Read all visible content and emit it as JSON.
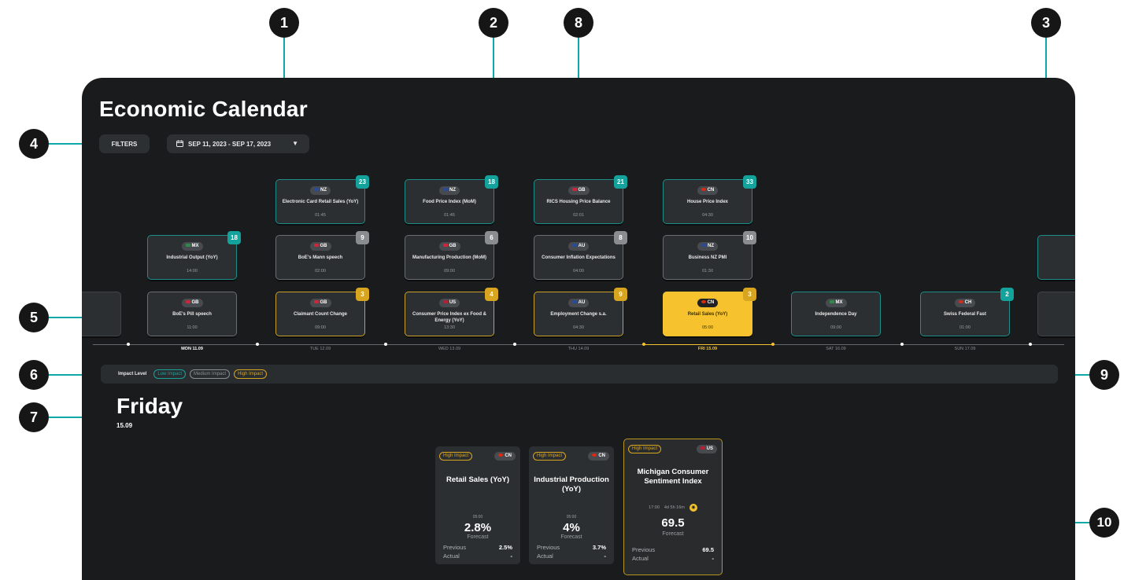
{
  "app": {
    "title": "Economic Calendar",
    "filters_label": "FILTERS",
    "date_range": "SEP 11, 2023 - SEP 17, 2023",
    "dropdown_arrow": "▼",
    "calendar_icon": "calendar-icon"
  },
  "colors": {
    "panel": "#191b1d",
    "low_impact": "#14a39c",
    "medium_impact": "#8a8d90",
    "high_impact": "#d8a520",
    "selected": "#f6c32e",
    "annotation_line": "#0fa7a7"
  },
  "cards": {
    "c1": {
      "flag": "NZ",
      "event": "Electronic Card Retail Sales (YoY)",
      "time": "01:45",
      "count": "23"
    },
    "c2": {
      "flag": "NZ",
      "event": "Food Price Index (MoM)",
      "time": "01:45",
      "count": "18"
    },
    "c3": {
      "flag": "GB",
      "event": "RICS Housing Price Balance",
      "time": "02:01",
      "count": "21"
    },
    "c4": {
      "flag": "CN",
      "event": "House Price Index",
      "time": "04:30",
      "count": "33"
    },
    "c5": {
      "flag": "MX",
      "event": "Industrial Output (YoY)",
      "time": "14:00",
      "count": "18"
    },
    "c6": {
      "flag": "GB",
      "event": "BoE's Mann speech",
      "time": "02:00",
      "count": "9"
    },
    "c7": {
      "flag": "GB",
      "event": "Manufacturing Production (MoM)",
      "time": "09:00",
      "count": "6"
    },
    "c8": {
      "flag": "AU",
      "event": "Consumer Inflation Expectations",
      "time": "04:00",
      "count": "8"
    },
    "c9": {
      "flag": "NZ",
      "event": "Business NZ PMI",
      "time": "01:30",
      "count": "10"
    },
    "c10": {
      "flag": "GB",
      "event": "BoE's Pill speech",
      "time": "11:00"
    },
    "c11": {
      "flag": "GB",
      "event": "Claimant Count Change",
      "time": "09:00",
      "count": "3"
    },
    "c12": {
      "flag": "US",
      "event": "Consumer Price Index ex Food & Energy (YoY)",
      "time": "13:30",
      "count": "4"
    },
    "c13": {
      "flag": "AU",
      "event": "Employment Change s.a.",
      "time": "04:30",
      "count": "9"
    },
    "c14": {
      "flag": "CN",
      "event": "Retail Sales (YoY)",
      "time": "05:00",
      "count": "3"
    },
    "c15": {
      "flag": "MX",
      "event": "Independence Day",
      "time": "09:00"
    },
    "c16": {
      "flag": "CH",
      "event": "Swiss Federal Fast",
      "time": "01:00",
      "count": "2"
    }
  },
  "timeline": {
    "days": [
      "MON 11.09",
      "TUE 12.09",
      "WED 13.09",
      "THU 14.09",
      "FRI 15.09",
      "SAT 16.09",
      "SUN 17.09"
    ]
  },
  "impact": {
    "label": "Impact Level",
    "low": "Low Impact",
    "medium": "Medium Impact",
    "high": "High Impact"
  },
  "selected_day": {
    "name": "Friday",
    "date": "15.09"
  },
  "details": {
    "d1": {
      "impact": "High Impact",
      "flag": "CN",
      "name": "Retail Sales (YoY)",
      "time": "05:00",
      "value": "2.8%",
      "forecast_label": "Forecast",
      "previous_label": "Previous",
      "previous": "2.5%",
      "actual_label": "Actual",
      "actual": "-"
    },
    "d2": {
      "impact": "High Impact",
      "flag": "CN",
      "name": "Industrial Production (YoY)",
      "time": "05:00",
      "value": "4%",
      "forecast_label": "Forecast",
      "previous_label": "Previous",
      "previous": "3.7%",
      "actual_label": "Actual",
      "actual": "-"
    },
    "d3": {
      "impact": "High Impact",
      "flag": "US",
      "name": "Michigan Consumer Sentiment Index",
      "time": "17:00",
      "countdown": "4d 5h 16m",
      "value": "69.5",
      "forecast_label": "Forecast",
      "previous_label": "Previous",
      "previous": "69.5",
      "actual_label": "Actual",
      "actual": "-"
    }
  },
  "annotations": [
    "1",
    "2",
    "8",
    "3",
    "4",
    "5",
    "6",
    "7",
    "9",
    "10"
  ]
}
